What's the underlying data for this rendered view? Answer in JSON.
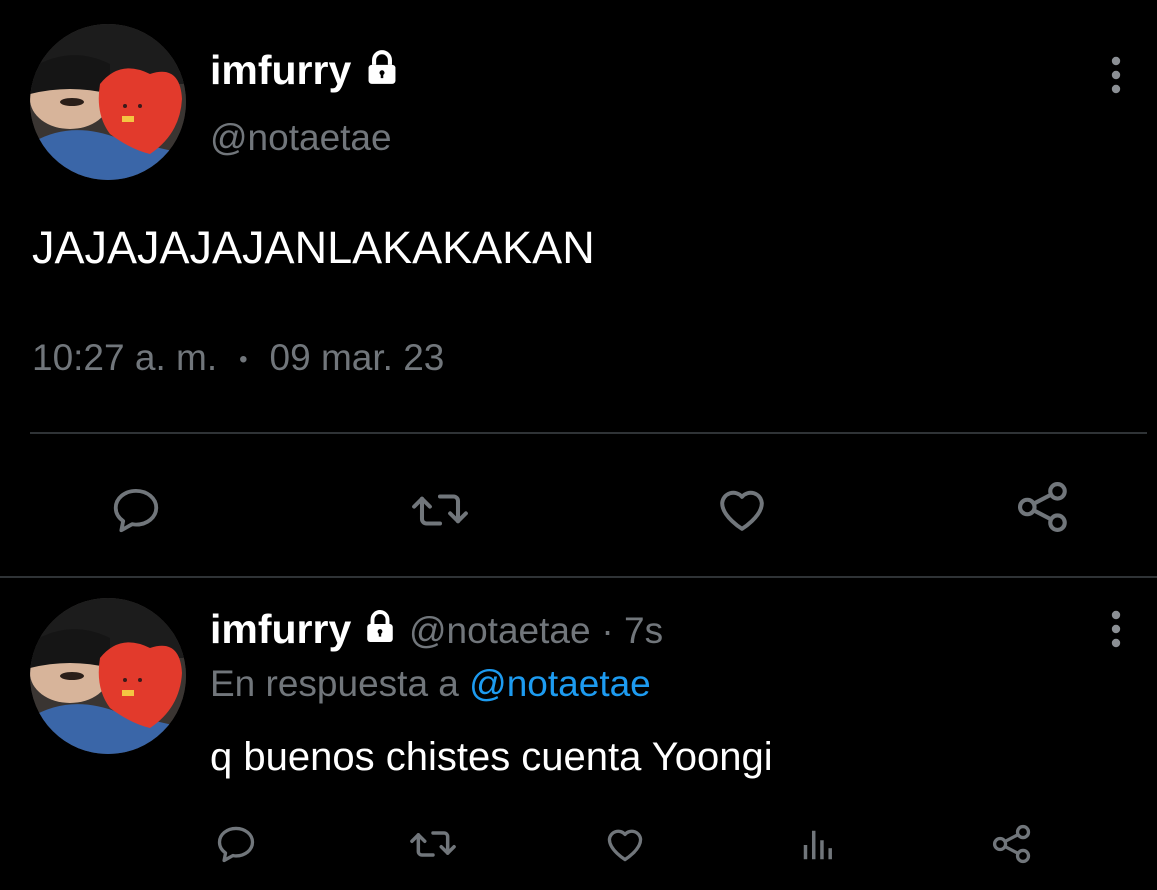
{
  "tweet": {
    "author_name": "imfurry",
    "author_handle": "@notaetae",
    "text": "JAJAJAJAJANLAKAKAKAN",
    "time": "10:27 a. m.",
    "separator": "•",
    "date": "09 mar. 23",
    "protected_icon": "lock-icon",
    "more_icon": "more-vertical-icon",
    "actions": [
      "reply-icon",
      "retweet-icon",
      "like-icon",
      "share-icon"
    ]
  },
  "reply": {
    "author_name": "imfurry",
    "author_handle": "@notaetae",
    "age": "· 7s",
    "reply_prefix": "En respuesta a",
    "reply_mention": "@notaetae",
    "text": "q buenos chistes cuenta Yoongi",
    "protected_icon": "lock-icon",
    "more_icon": "more-vertical-icon",
    "actions": [
      "reply-icon",
      "retweet-icon",
      "like-icon",
      "analytics-icon",
      "share-icon"
    ]
  },
  "colors": {
    "background": "#000000",
    "primary_text": "#ffffff",
    "secondary_text": "#71767b",
    "link": "#1d9bf0",
    "divider": "#2f3336"
  }
}
